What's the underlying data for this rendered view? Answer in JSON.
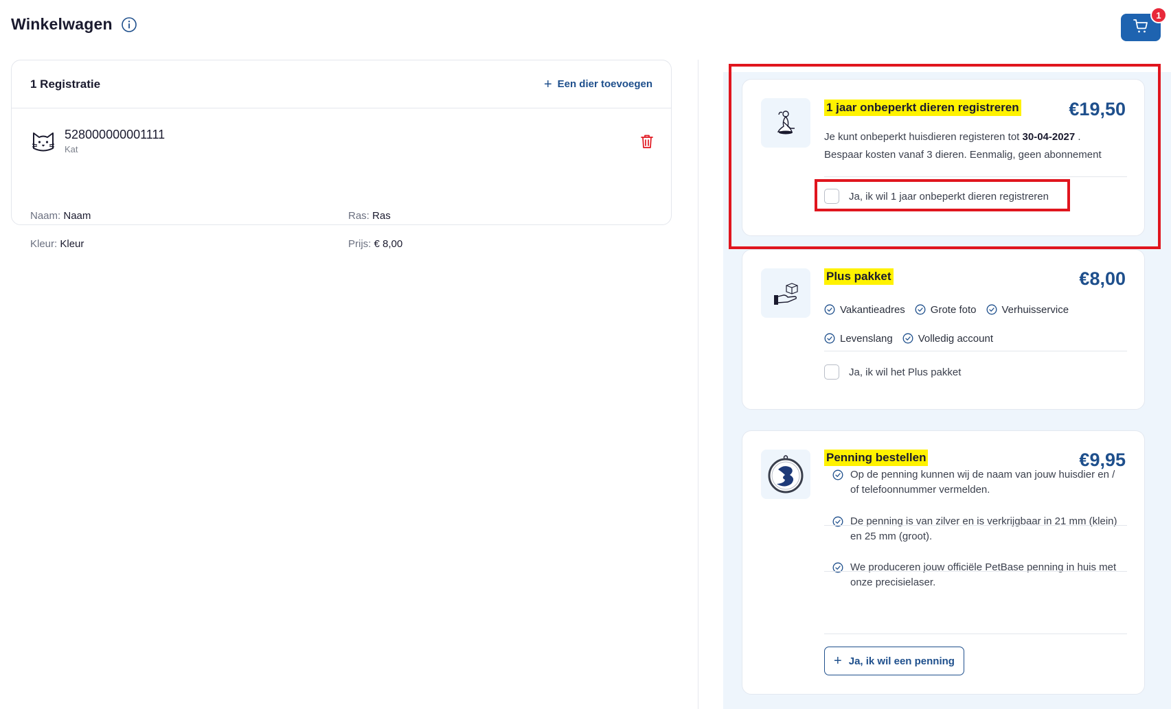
{
  "header": {
    "title": "Winkelwagen",
    "cart_badge": "1"
  },
  "registration_card": {
    "count_label": "1 Registratie",
    "add_animal_label": "Een dier toevoegen",
    "animal": {
      "chip_number": "528000000001111",
      "species": "Kat",
      "name_label": "Naam:",
      "name_value": "Naam",
      "breed_label": "Ras:",
      "breed_value": "Ras",
      "color_label": "Kleur:",
      "color_value": "Kleur",
      "price_label": "Prijs:",
      "price_value": "€ 8,00"
    }
  },
  "offers": {
    "unlimited": {
      "title": "1 jaar onbeperkt dieren registreren",
      "price": "€19,50",
      "desc_prefix": "Je kunt onbeperkt huisdieren registeren tot",
      "desc_date": "30-04-2027",
      "desc_suffix": ".",
      "desc_line2": "Bespaar kosten vanaf 3 dieren. Eenmalig, geen abonnement",
      "checkbox_label": "Ja, ik wil 1 jaar onbeperkt dieren registreren"
    },
    "plus": {
      "title": "Plus pakket",
      "price": "€8,00",
      "features": [
        "Vakantieadres",
        "Grote foto",
        "Verhuisservice",
        "Levenslang",
        "Volledig account"
      ],
      "checkbox_label": "Ja, ik wil het Plus pakket"
    },
    "penning": {
      "title": "Penning bestellen",
      "price": "€9,95",
      "bullets": [
        "Op de penning kunnen wij de naam van jouw huisdier en / of telefoonnummer vermelden.",
        "De penning is van zilver en is verkrijgbaar in 21 mm (klein) en 25 mm (groot).",
        "We produceren jouw officiële PetBase penning in huis met onze precisielaser."
      ],
      "button_label": "Ja, ik wil een penning"
    }
  },
  "colors": {
    "primary": "#1e63b0",
    "accent_text": "#1e4f8c",
    "highlight": "#fff200",
    "annotation_red": "#e0151e",
    "badge_red": "#e8293a",
    "panel_bg": "#eef5fc"
  },
  "icons": [
    "info-icon",
    "cart-icon",
    "plus-icon",
    "cat-icon",
    "trash-icon",
    "check-circle-icon",
    "yoga-person-icon",
    "hand-box-icon",
    "penning-logo-icon"
  ]
}
